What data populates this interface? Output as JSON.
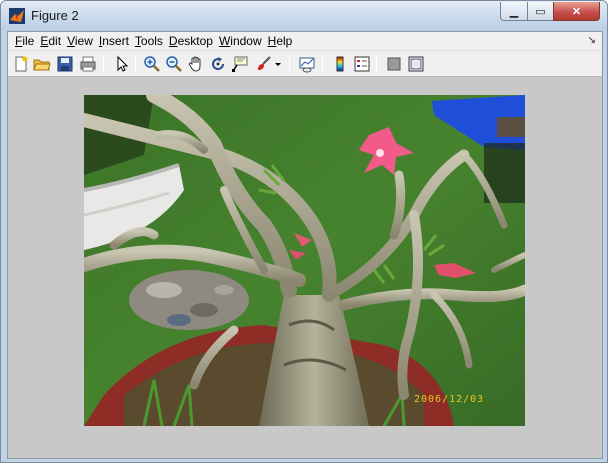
{
  "window": {
    "title": "Figure 2"
  },
  "menu": [
    "File",
    "Edit",
    "View",
    "Insert",
    "Tools",
    "Desktop",
    "Window",
    "Help"
  ],
  "menu_access_keys": [
    "F",
    "E",
    "V",
    "I",
    "T",
    "D",
    "W",
    "H"
  ],
  "toolbar": {
    "buttons": [
      {
        "icon": "new-figure-icon"
      },
      {
        "icon": "open-file-icon"
      },
      {
        "icon": "save-icon"
      },
      {
        "icon": "print-icon"
      },
      {
        "icon": "edit-plot-pointer-icon"
      },
      {
        "icon": "zoom-in-icon"
      },
      {
        "icon": "zoom-out-icon"
      },
      {
        "icon": "pan-hand-icon"
      },
      {
        "icon": "rotate-3d-icon"
      },
      {
        "icon": "data-cursor-icon"
      },
      {
        "icon": "brush-icon"
      },
      {
        "icon": "brush-dropdown-icon"
      },
      {
        "icon": "link-plot-icon"
      },
      {
        "icon": "colorbar-icon"
      },
      {
        "icon": "legend-icon"
      },
      {
        "icon": "hide-plot-tools-icon"
      },
      {
        "icon": "show-plot-tools-icon"
      }
    ]
  },
  "image": {
    "date_stamp": "2006/12/03"
  },
  "colors": {
    "figure_bg": "#c8c8c8",
    "menubar_bg": "#f0f0f0",
    "title_bar": "#c8d8ea"
  }
}
